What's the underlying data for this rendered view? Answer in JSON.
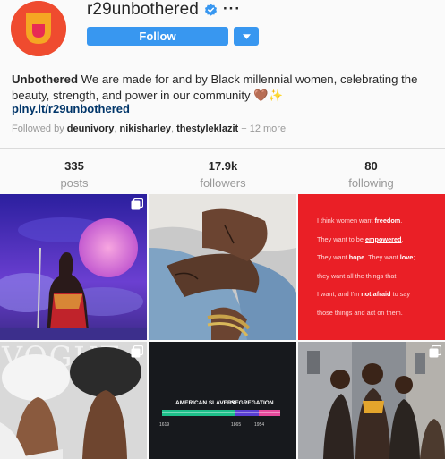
{
  "profile": {
    "username": "r29unbothered",
    "follow_label": "Follow",
    "bio_name": "Unbothered",
    "bio_text": " We are made for and by Black millennial women, celebrating the beauty, strength, and power in our community ",
    "bio_emoji": "🤎✨",
    "link": "plny.it/r29unbothered",
    "followed_by_prefix": "Followed by ",
    "followed_by_users": [
      "deunivory",
      "nikisharley",
      "thestyleklazit"
    ],
    "followed_by_more": " + 12 more"
  },
  "stats": [
    {
      "value": "335",
      "label": "posts"
    },
    {
      "value": "17.9k",
      "label": "followers"
    },
    {
      "value": "80",
      "label": "following"
    }
  ],
  "posts": {
    "quote_lines": [
      {
        "pre": "I think women want ",
        "bold": "freedom",
        "post": "."
      },
      {
        "pre": "They want to be ",
        "bold": "empowered",
        "post": "."
      },
      {
        "pre": "They want ",
        "bold": "hope",
        "post": ". They want ",
        "bold2": "love",
        "post2": ";"
      },
      {
        "pre": "they want all the things that",
        "bold": "",
        "post": ""
      },
      {
        "pre": "I want, and I'm ",
        "bold": "not afraid",
        "post": " to say"
      },
      {
        "pre": "those things and act on them.",
        "bold": "",
        "post": ""
      }
    ],
    "vogue_text": "VOGUE",
    "timeline_title_1": "AMERICAN SLAVERY",
    "timeline_title_2": "SEGREGATION",
    "timeline_years": [
      "1619",
      "1865",
      "1954"
    ]
  },
  "colors": {
    "accent": "#3897f0",
    "brand": "#ec4d2e",
    "link": "#003569"
  }
}
